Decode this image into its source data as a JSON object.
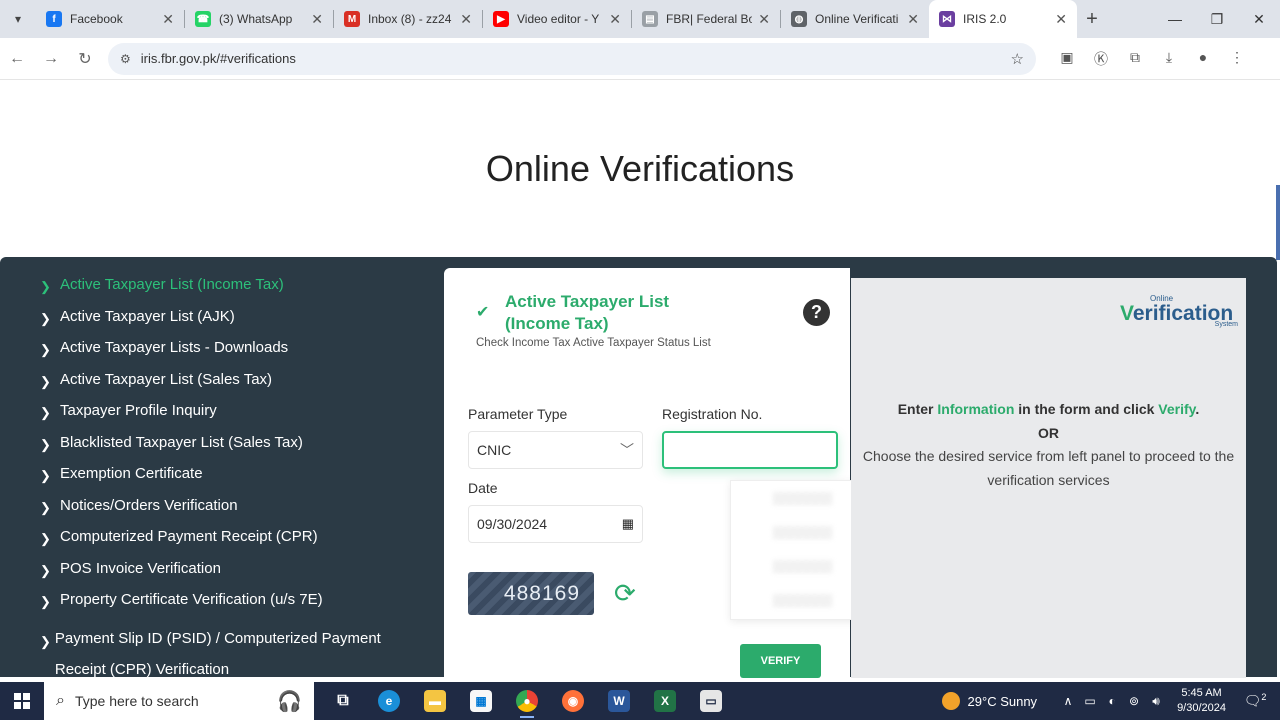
{
  "browser": {
    "tabs": [
      {
        "title": "Facebook",
        "icon": "facebook-icon",
        "color": "#1877f2",
        "glyph": "f"
      },
      {
        "title": "(3) WhatsApp",
        "icon": "whatsapp-icon",
        "color": "#25d366",
        "glyph": "☎"
      },
      {
        "title": "Inbox (8) - zz24",
        "icon": "gmail-icon",
        "color": "#d93025",
        "glyph": "M"
      },
      {
        "title": "Video editor - Y",
        "icon": "youtube-icon",
        "color": "#ff0000",
        "glyph": "▶"
      },
      {
        "title": "FBR| Federal Bo",
        "icon": "document-icon",
        "color": "#9aa0a6",
        "glyph": "▤"
      },
      {
        "title": "Online Verificati",
        "icon": "globe-icon",
        "color": "#5f6368",
        "glyph": "◍"
      },
      {
        "title": "IRIS 2.0",
        "icon": "iris-icon",
        "color": "#6b3fa0",
        "glyph": "⋈"
      }
    ],
    "url": "iris.fbr.gov.pk/#verifications"
  },
  "page": {
    "title": "Online Verifications"
  },
  "sidebar": {
    "items": [
      {
        "label": "Active Taxpayer List (Income Tax)"
      },
      {
        "label": "Active Taxpayer List (AJK)"
      },
      {
        "label": "Active Taxpayer Lists - Downloads"
      },
      {
        "label": "Active Taxpayer List (Sales Tax)"
      },
      {
        "label": "Taxpayer Profile Inquiry"
      },
      {
        "label": "Blacklisted Taxpayer List (Sales Tax)"
      },
      {
        "label": "Exemption Certificate"
      },
      {
        "label": "Notices/Orders Verification"
      },
      {
        "label": "Computerized Payment Receipt (CPR)"
      },
      {
        "label": "POS Invoice Verification"
      },
      {
        "label": "Property Certificate Verification (u/s 7E)"
      },
      {
        "label": "Payment Slip ID (PSID) / Computerized Payment Receipt (CPR) Verification"
      }
    ]
  },
  "form": {
    "title": "Active Taxpayer List (Income Tax)",
    "subtitle": "Check Income Tax Active Taxpayer Status List",
    "param_label": "Parameter Type",
    "param_value": "CNIC",
    "reg_label": "Registration No.",
    "reg_value": "",
    "date_label": "Date",
    "date_value": "09/30/2024",
    "captcha": "488169",
    "verify_label": "VERIFY"
  },
  "info": {
    "logo_small": "Online",
    "logo_main_v": "V",
    "logo_main_rest": "erification",
    "logo_sys": "System",
    "line1_a": "Enter ",
    "line1_b": "Information",
    "line1_c": " in the form and click ",
    "line1_d": "Verify",
    "line1_e": ".",
    "or": "OR",
    "line2": "Choose the desired service from left panel to proceed to the verification services"
  },
  "taskbar": {
    "search_placeholder": "Type here to search",
    "weather": "29°C  Sunny",
    "time": "5:45 AM",
    "date": "9/30/2024",
    "notifications": "2"
  }
}
